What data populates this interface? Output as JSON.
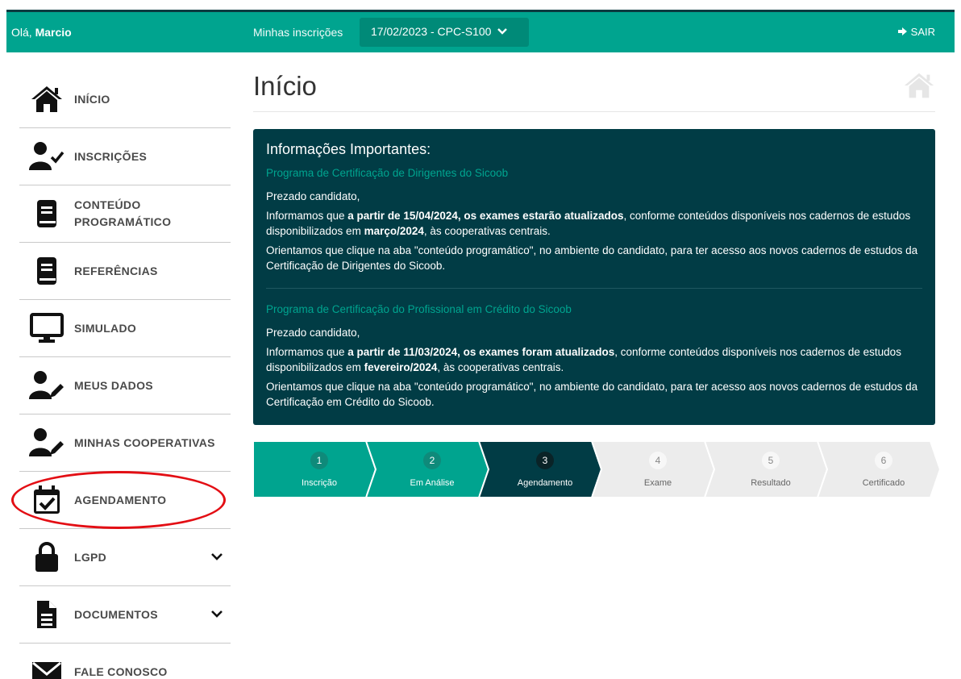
{
  "header": {
    "greeting_prefix": "Olá, ",
    "user_name": "Marcio",
    "subscriptions_label": "Minhas inscrições",
    "subscription_selected": "17/02/2023 - CPC-S100",
    "logout_label": "SAIR"
  },
  "sidebar": {
    "items": [
      {
        "label": "INÍCIO",
        "icon": "home-icon"
      },
      {
        "label": "INSCRIÇÕES",
        "icon": "user-check-icon"
      },
      {
        "label": "CONTEÚDO PROGRAMÁTICO",
        "icon": "book-icon"
      },
      {
        "label": "REFERÊNCIAS",
        "icon": "book-icon"
      },
      {
        "label": "SIMULADO",
        "icon": "monitor-icon"
      },
      {
        "label": "MEUS DADOS",
        "icon": "user-edit-icon"
      },
      {
        "label": "MINHAS COOPERATIVAS",
        "icon": "user-edit-icon"
      },
      {
        "label": "AGENDAMENTO",
        "icon": "calendar-check-icon"
      },
      {
        "label": "LGPD",
        "icon": "lock-icon"
      },
      {
        "label": "DOCUMENTOS",
        "icon": "file-icon"
      },
      {
        "label": "FALE CONOSCO",
        "icon": "envelope-icon"
      }
    ]
  },
  "main": {
    "title": "Início",
    "info": {
      "heading": "Informações Importantes:",
      "sections": [
        {
          "program": "Programa de Certificação de Dirigentes do Sicoob",
          "salutation": "Prezado candidato,",
          "p1_a": "Informamos que ",
          "p1_b": "a partir de 15/04/2024, os exames estarão atualizados",
          "p1_c": ", conforme conteúdos disponíveis nos cadernos de estudos disponibilizados em ",
          "p1_d": "março/2024",
          "p1_e": ", às cooperativas centrais.",
          "p2": "Orientamos que clique na aba \"conteúdo programático\", no ambiente do candidato, para ter acesso aos novos cadernos de estudos da Certificação de Dirigentes do Sicoob."
        },
        {
          "program": "Programa de Certificação do Profissional em Crédito do Sicoob",
          "salutation": "Prezado candidato,",
          "p1_a": "Informamos que ",
          "p1_b": "a partir de 11/03/2024, os exames foram atualizados",
          "p1_c": ", conforme conteúdos disponíveis nos cadernos de estudos disponibilizados em ",
          "p1_d": "fevereiro/2024",
          "p1_e": ", às cooperativas centrais.",
          "p2": "Orientamos que clique na aba \"conteúdo programático\", no ambiente do candidato, para ter acesso aos novos cadernos de estudos da Certificação em Crédito do Sicoob."
        }
      ]
    },
    "steps": [
      {
        "num": "1",
        "label": "Inscrição",
        "state": "done"
      },
      {
        "num": "2",
        "label": "Em Análise",
        "state": "done"
      },
      {
        "num": "3",
        "label": "Agendamento",
        "state": "current"
      },
      {
        "num": "4",
        "label": "Exame",
        "state": "pending"
      },
      {
        "num": "5",
        "label": "Resultado",
        "state": "pending"
      },
      {
        "num": "6",
        "label": "Certificado",
        "state": "pending"
      }
    ]
  },
  "colors": {
    "brand": "#00a48f",
    "dark_teal": "#013c45",
    "highlight": "#e30e14",
    "pending": "#ececec"
  }
}
